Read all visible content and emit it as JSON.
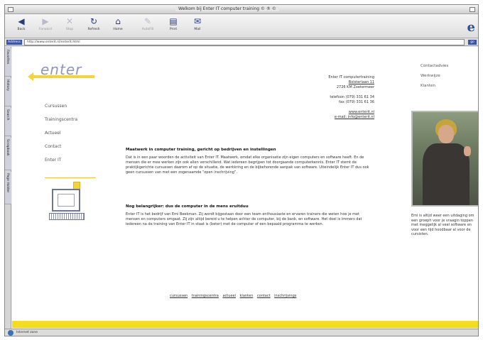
{
  "window": {
    "title": "Welkom bij Enter IT computer training © ® ©"
  },
  "toolbar": {
    "buttons": [
      {
        "label": "Back",
        "icon": "back-arrow-icon",
        "enabled": true
      },
      {
        "label": "Forward",
        "icon": "forward-arrow-icon",
        "enabled": false
      },
      {
        "label": "Stop",
        "icon": "stop-icon",
        "enabled": false
      },
      {
        "label": "Refresh",
        "icon": "refresh-icon",
        "enabled": true
      },
      {
        "label": "Home",
        "icon": "home-icon",
        "enabled": true
      },
      {
        "label": "AutoFill",
        "icon": "autofill-icon",
        "enabled": false
      },
      {
        "label": "Print",
        "icon": "print-icon",
        "enabled": true
      },
      {
        "label": "Mail",
        "icon": "mail-icon",
        "enabled": true
      }
    ]
  },
  "addressbar": {
    "label": "Address",
    "value": "http://www.enterit.nl/enterit.html",
    "go": "go"
  },
  "sidebar": {
    "tabs": [
      "Favorites",
      "History",
      "Search",
      "Scrapbook",
      "Page Holder"
    ]
  },
  "site": {
    "logo_text": "enter",
    "nav": [
      "Cursussen",
      "Trainingscentra",
      "Actueel",
      "Contact",
      "Enter IT"
    ],
    "address": [
      "Enter IT computertraining",
      "Bolsterlaan 11",
      "2726 KM Zoetermeer",
      "",
      "telefoon (079) 331 61 34",
      "fax (079) 331 61 36",
      "",
      "www.enterit.nl",
      "e-mail: info@enterit.nl"
    ],
    "topnav": [
      "Contactadvies",
      "Werkwijze",
      "Klanten"
    ],
    "heading": "Maatwerk in computer training, gericht op bedrijven en instellingen",
    "paragraph1": "Dat is in een paar woorden de activiteit van Enter IT. Maatwerk, omdat elke organisatie zijn eigen computers en software heeft. En de mensen die er mee werken zijn ook allen verschillend. Wat iedereen begrijpen tot doorgaande computerkennis. Enter IT stemt de praktijkgerichte cursussen daarom af op de situatie, de werkkring en de bijbehorende aanpak van software. Uiteindelijk Enter IT dus ook geen cursussen van met een zogenaamde “open inschrijving”.",
    "heading2": "Nog belangrijker: dus de computer in de mens eruitduu",
    "paragraph2": "Enter IT is het bedrijf van Emi Beekman. Zij wordt bijgestaan door een team enthousiaste en ervaren trainers die weten hoe je met mensen en computers omgaat. Zij zijn altijd bereid u te helpen achter de computer, bij de bank, en software. Het doel is immers dat iedereen na de training van Enter IT in staat is (beter) met de computer of een bepaald programma te werken.",
    "caption": "Emi is altijd weer een uitdaging om een groeph voor je vraagin toppen met meggelijk al veel software en voor een tijd hoodbaar al voor de cursisten.",
    "footer_links": [
      "cursussen",
      "trainingscentra",
      "actueel",
      "klanten",
      "contact",
      "inschrijvings"
    ]
  },
  "status": {
    "text": "Internet zone"
  }
}
